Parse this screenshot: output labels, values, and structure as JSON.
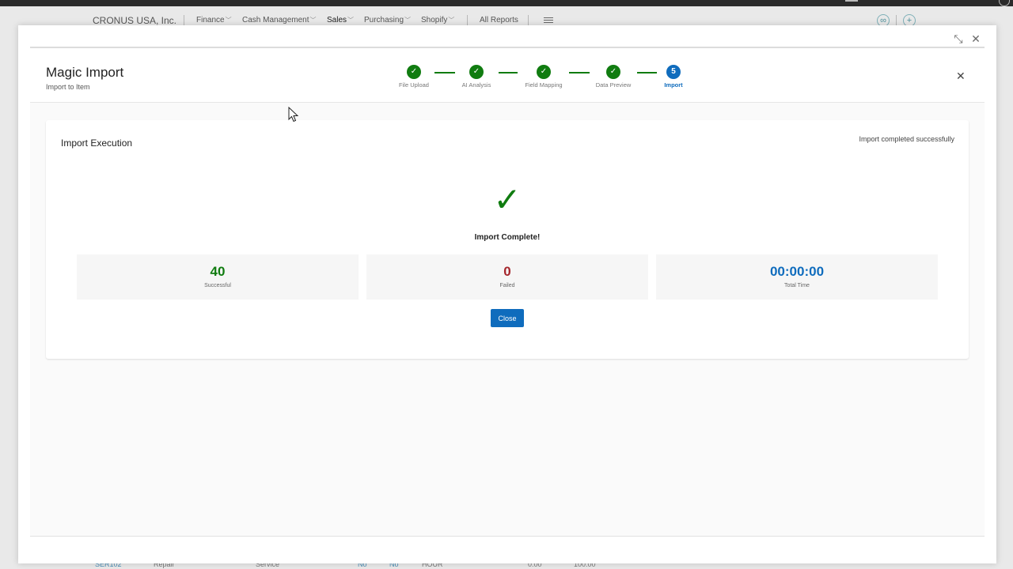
{
  "background_app": {
    "company": "CRONUS USA, Inc.",
    "nav": [
      {
        "label": "Finance"
      },
      {
        "label": "Cash Management"
      },
      {
        "label": "Sales"
      },
      {
        "label": "Purchasing"
      },
      {
        "label": "Shopify"
      }
    ],
    "all_reports": "All Reports",
    "bg_row": {
      "no": "SER102",
      "description": "Repair",
      "type": "Service",
      "flag1": "No",
      "flag2": "No",
      "unit": "HOUR",
      "cost": "0.00",
      "price": "100.00"
    }
  },
  "dialog": {
    "title": "Magic Import",
    "subtitle": "Import to Item",
    "steps": [
      {
        "label": "File Upload",
        "state": "done"
      },
      {
        "label": "AI Analysis",
        "state": "done"
      },
      {
        "label": "Field Mapping",
        "state": "done"
      },
      {
        "label": "Data Preview",
        "state": "done"
      },
      {
        "label": "Import",
        "state": "current",
        "number": "5"
      }
    ],
    "check_glyph": "✓"
  },
  "execution": {
    "title": "Import Execution",
    "status": "Import completed successfully",
    "complete_text": "Import Complete!",
    "check_glyph": "✓",
    "stats": {
      "successful": {
        "value": "40",
        "label": "Successful"
      },
      "failed": {
        "value": "0",
        "label": "Failed"
      },
      "total_time": {
        "value": "00:00:00",
        "label": "Total Time"
      }
    },
    "close_label": "Close"
  },
  "colors": {
    "success": "#107c10",
    "failed": "#a4262c",
    "accent": "#0f6cbd"
  }
}
